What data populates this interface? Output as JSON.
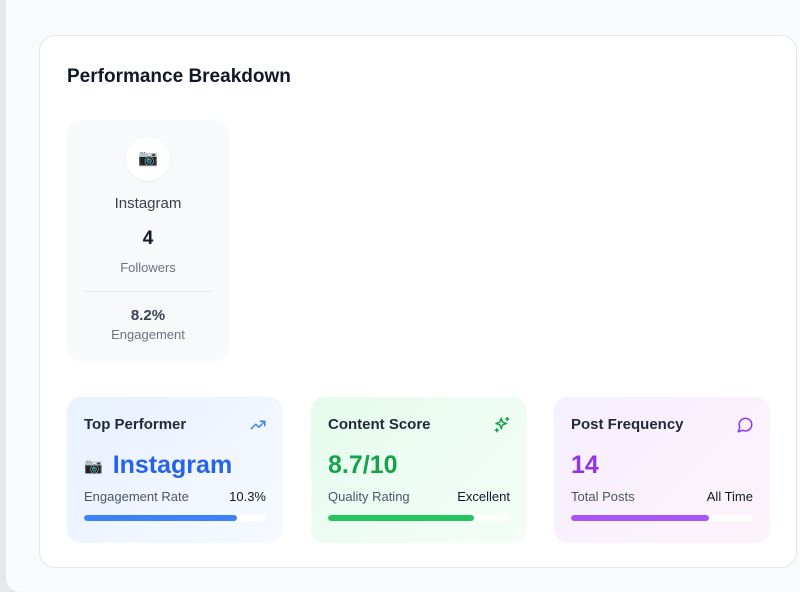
{
  "section": {
    "title": "Performance Breakdown"
  },
  "platforms": [
    {
      "name": "Instagram",
      "icon": "📷",
      "followers": "4",
      "followers_label": "Followers",
      "engagement": "8.2%",
      "engagement_label": "Engagement"
    }
  ],
  "stats": {
    "top_performer": {
      "title": "Top Performer",
      "icon": "trending-up-icon",
      "emoji": "📷",
      "value": "Instagram",
      "label": "Engagement Rate",
      "label_value": "10.3%",
      "progress": 0.84,
      "color": "#3b82f6",
      "value_color": "#2563eb"
    },
    "content_score": {
      "title": "Content Score",
      "icon": "sparkles-icon",
      "value": "8.7/10",
      "label": "Quality Rating",
      "label_value": "Excellent",
      "progress": 0.8,
      "color": "#22c55e",
      "value_color": "#16a34a"
    },
    "post_frequency": {
      "title": "Post Frequency",
      "icon": "message-circle-icon",
      "value": "14",
      "label": "Total Posts",
      "label_value": "All Time",
      "progress": 0.76,
      "color": "#a855f7",
      "value_color": "#9333ea"
    }
  }
}
